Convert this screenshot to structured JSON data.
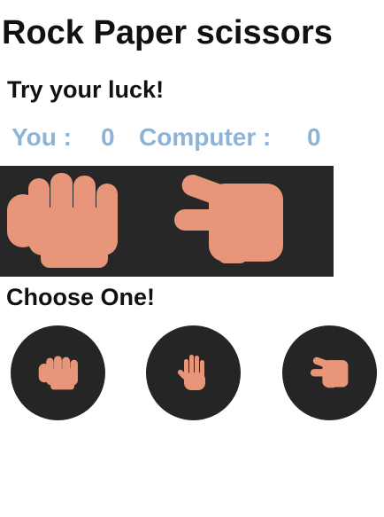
{
  "app": {
    "title": "Rock Paper scissors",
    "subtitle": "Try your luck!"
  },
  "score": {
    "user_label": "You :",
    "user_score": "0",
    "computer_label": "Computer :",
    "computer_score": "0"
  },
  "result": {
    "user_hand_icon": "rock-fist-icon",
    "computer_hand_icon": "scissors-hand-icon"
  },
  "choices": {
    "heading": "Choose One!",
    "items": [
      {
        "name": "rock",
        "icon": "rock-fist-icon"
      },
      {
        "name": "paper",
        "icon": "paper-hand-icon"
      },
      {
        "name": "scissors",
        "icon": "scissors-hand-icon"
      }
    ]
  },
  "colors": {
    "score_text": "#8cb4d8",
    "panel_background": "#272727",
    "button_background": "#252525",
    "hand_skin": "#e8967a"
  }
}
